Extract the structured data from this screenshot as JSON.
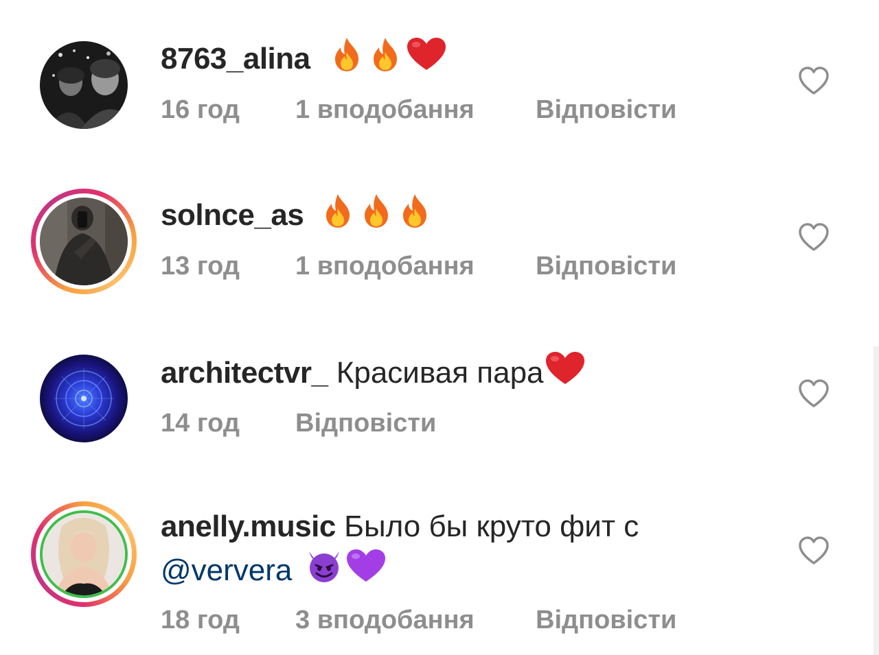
{
  "comments": [
    {
      "username": "8763_alina",
      "text": "",
      "mention": "",
      "emojis": [
        "fire",
        "fire",
        "red-heart"
      ],
      "time": "16 год",
      "likes": "1 вподобання",
      "reply": "Відповісти",
      "has_story_ring": false
    },
    {
      "username": "solnce_as",
      "text": "",
      "mention": "",
      "emojis": [
        "fire",
        "fire",
        "fire"
      ],
      "time": "13 год",
      "likes": "1 вподобання",
      "reply": "Відповісти",
      "has_story_ring": true
    },
    {
      "username": "architectvr_",
      "text": "Красивая пара",
      "mention": "",
      "emojis": [
        "red-heart"
      ],
      "time": "14 год",
      "likes": "",
      "reply": "Відповісти",
      "has_story_ring": false
    },
    {
      "username": "anelly.music",
      "text": "Было бы круто фит с",
      "mention": "@ververa",
      "emojis": [
        "smiling-devil",
        "purple-heart"
      ],
      "time": "18 год",
      "likes": "3 вподобання",
      "reply": "Відповісти",
      "has_story_ring": true
    }
  ],
  "colors": {
    "text": "#262626",
    "meta": "#8e8e8e",
    "mention": "#00376b",
    "heart_outline": "#8e8e8e"
  },
  "icons": {
    "like": "heart-outline-icon"
  }
}
